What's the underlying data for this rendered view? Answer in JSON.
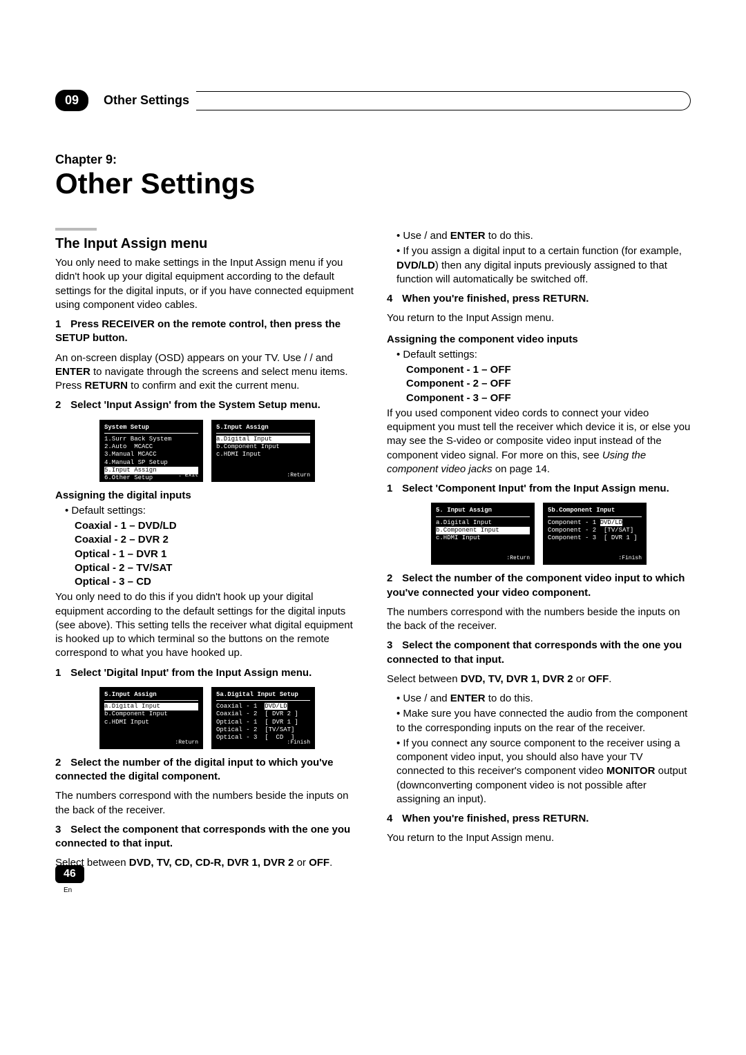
{
  "header": {
    "badge": "09",
    "title": "Other Settings"
  },
  "chapter": {
    "label": "Chapter 9:",
    "title": "Other Settings"
  },
  "left": {
    "sectionTitle": "The Input Assign menu",
    "intro": "You only need to make settings in the Input Assign menu if you didn't hook up your digital equipment according to the default settings for the digital inputs, or if you have connected equipment using component video cables.",
    "step1": {
      "num": "1",
      "text": "Press RECEIVER on the remote control, then press the SETUP button."
    },
    "step1note": "An on-screen display (OSD) appears on your TV. Use  /  /  /  and ENTER to navigate through the screens and select menu items. Press RETURN to confirm and exit the current menu.",
    "step2": {
      "num": "2",
      "text": "Select 'Input Assign' from the System Setup menu."
    },
    "osd1a": {
      "title": "System  Setup",
      "rows": [
        "1.Surr Back System",
        "2.Auto  MCACC",
        "3.Manual MCACC",
        "4.Manual SP Setup",
        "5.Input Assign",
        "6.Other Setup"
      ],
      "hl": 4,
      "foot": ": Exit"
    },
    "osd1b": {
      "title": "5.Input  Assign",
      "rows": [
        "a.Digital Input",
        "b.Component Input",
        "c.HDMI Input"
      ],
      "hl": 0,
      "foot": ":Return"
    },
    "sub1": "Assigning the digital inputs",
    "defaults": "Default settings:",
    "defList": [
      "Coaxial - 1 – DVD/LD",
      "Coaxial - 2 – DVR 2",
      "Optical - 1 – DVR 1",
      "Optical - 2 – TV/SAT",
      "Optical - 3 – CD"
    ],
    "para2": "You only need to do this if you didn't hook up your digital equipment according to the default settings for the digital inputs (see above). This setting tells the receiver what digital equipment is hooked up to which terminal so the buttons on the remote correspond to what you have hooked up.",
    "step3": {
      "num": "1",
      "text": "Select 'Digital Input' from the Input Assign menu."
    },
    "osd2a": {
      "title": "5.Input  Assign",
      "rows": [
        "a.Digital Input",
        "b.Component Input",
        "c.HDMI Input"
      ],
      "hl": 0,
      "foot": ":Return"
    },
    "osd2b": {
      "title": "5a.Digital Input Setup",
      "rows": [
        "Coaxial - 1  [DVD/LD]",
        "Coaxial - 2  [ DVR 2 ]",
        "Optical - 1  [ DVR 1 ]",
        "Optical - 2  [TV/SAT]",
        "Optical - 3  [  CD  ]"
      ],
      "hlInline": 0,
      "foot": ":Finish"
    },
    "step4": {
      "num": "2",
      "text": "Select the number of the digital input to which you've connected the digital component."
    },
    "step4note": "The numbers correspond with the numbers beside the inputs on the back of the receiver.",
    "step5": {
      "num": "3",
      "text": "Select the component that corresponds with the one you connected to that input."
    },
    "step5noteA": "Select between ",
    "step5list": "DVD, TV, CD, CD-R, DVR 1, DVR 2",
    "step5or": " or ",
    "step5off": "OFF",
    "period": "."
  },
  "right": {
    "b1a": "Use  /  and ",
    "enter": "ENTER",
    "b1b": " to do this.",
    "b2a": "If you assign a digital input to a certain function (for example, ",
    "b2bold": "DVD/LD",
    "b2b": ") then any digital inputs previously assigned to that function will automatically be switched off.",
    "step4": {
      "num": "4",
      "text": "When you're finished, press RETURN."
    },
    "step4note": "You return to the Input Assign menu.",
    "sub2": "Assigning the component video inputs",
    "defaults": "Default settings:",
    "defList": [
      "Component - 1 – OFF",
      "Component - 2 – OFF",
      "Component - 3 – OFF"
    ],
    "para": "If you used component video cords to connect your video equipment you must tell the receiver which device it is, or else you may see the S-video or composite video input instead of the component video signal. For more on this, see Using the component video jacks on page 14.",
    "paraItalic": "Using the component video jacks",
    "stepC1": {
      "num": "1",
      "text": "Select 'Component Input' from the Input Assign menu."
    },
    "osd3a": {
      "title": "5. Input  Assign",
      "rows": [
        "a.Digital Input",
        "b.Component Input",
        "c.HDMI Input"
      ],
      "hl": 1,
      "foot": ":Return"
    },
    "osd3b": {
      "title": "5b.Component Input",
      "rows": [
        "Component - 1  [DVD/LD]",
        "Component - 2  [TV/SAT]",
        "Component - 3  [ DVR 1 ]"
      ],
      "hlInline": 0,
      "foot": ":Finish"
    },
    "stepC2": {
      "num": "2",
      "text": "Select the number of the component video input to which you've connected your video component."
    },
    "stepC2note": "The numbers correspond with the numbers beside the inputs on the back of the receiver.",
    "stepC3": {
      "num": "3",
      "text": "Select the component that corresponds with the one you connected to that input."
    },
    "stepC3noteA": "Select between ",
    "stepC3list": "DVD, TV, DVR 1, DVR 2",
    "stepC3or": " or ",
    "stepC3off": "OFF",
    "b3a": "Use  /  and ",
    "b3b": " to do this.",
    "b4": "Make sure you have connected the audio from the component to the corresponding inputs on the rear of the receiver.",
    "b5a": "If you connect any source component to the receiver using a component video input, you should also have your TV connected to this receiver's component video ",
    "monitor": "MONITOR",
    "b5b": " output (downconverting component video is not possible after assigning an input).",
    "stepC4": {
      "num": "4",
      "text": "When you're finished, press RETURN."
    },
    "stepC4note": "You return to the Input Assign menu."
  },
  "footer": {
    "page": "46",
    "lang": "En"
  }
}
